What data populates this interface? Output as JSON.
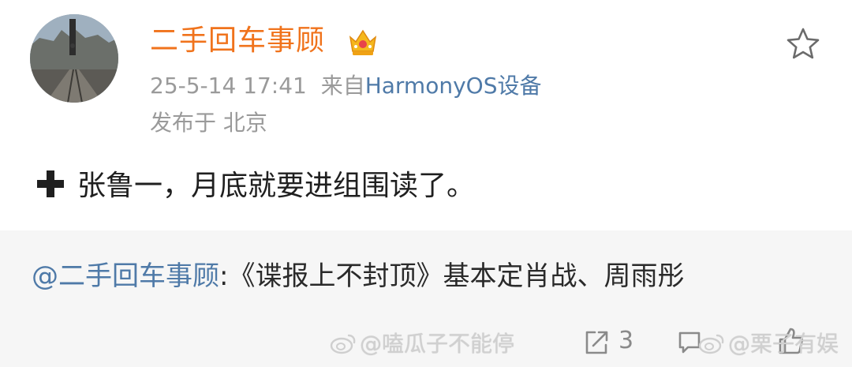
{
  "post": {
    "author": "二手回车事顾",
    "date": "25-5-14 17:41",
    "from_label": "来自",
    "source": "HarmonyOS设备",
    "location": "发布于 北京",
    "content": "张鲁一，月底就要进组围读了。"
  },
  "repost": {
    "mention": "@二手回车事顾",
    "text": ":《谍报上不封顶》基本定肖战、周雨彤"
  },
  "actions": {
    "share_count": "3"
  },
  "watermarks": {
    "left": "@嗑瓜子不能停",
    "right": "@栗子有娱"
  },
  "colors": {
    "username": "#f0731c",
    "link": "#4f7aa8",
    "meta": "#9a9a9a",
    "repost_bg": "#f6f6f6"
  },
  "icons": [
    "avatar",
    "crown-badge-icon",
    "star-icon",
    "plus-icon",
    "share-icon",
    "comment-icon",
    "like-icon",
    "weibo-logo-icon"
  ]
}
